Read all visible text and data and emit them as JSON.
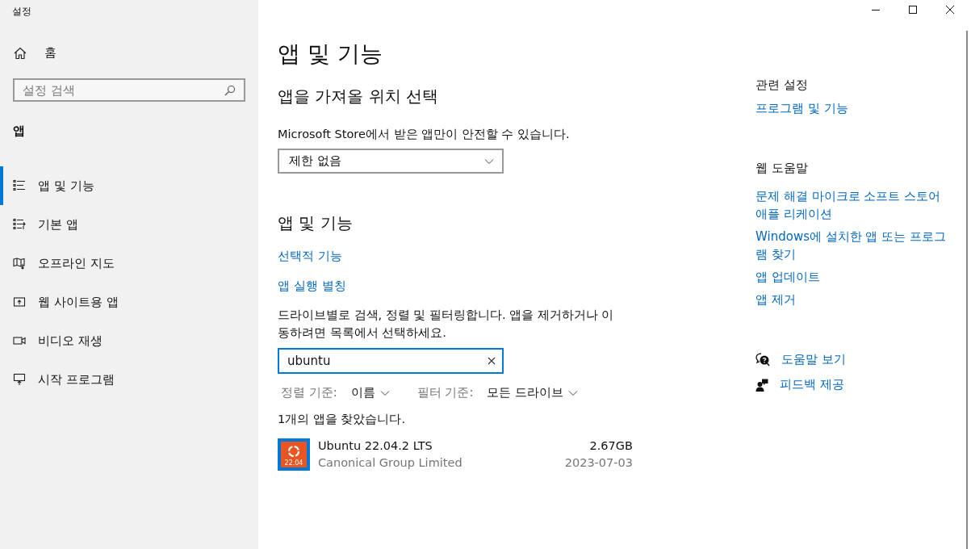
{
  "window": {
    "title": "설정"
  },
  "sidebar": {
    "home": "홈",
    "search": {
      "placeholder": "설정 검색"
    },
    "section": "앱",
    "items": [
      {
        "label": "앱 및 기능",
        "selected": true
      },
      {
        "label": "기본 앱",
        "selected": false
      },
      {
        "label": "오프라인 지도",
        "selected": false
      },
      {
        "label": "웹 사이트용 앱",
        "selected": false
      },
      {
        "label": "비디오 재생",
        "selected": false
      },
      {
        "label": "시작 프로그램",
        "selected": false
      }
    ]
  },
  "main": {
    "title": "앱 및 기능",
    "source": {
      "heading": "앱을 가져올 위치 선택",
      "description": "Microsoft Store에서 받은 앱만이 안전할 수 있습니다.",
      "dropdown": "제한 없음"
    },
    "apps": {
      "heading": "앱 및 기능",
      "links": [
        "선택적 기능",
        "앱 실행 별칭"
      ],
      "description": "드라이브별로 검색, 정렬 및 필터링합니다. 앱을 제거하거나 이동하려면 목록에서 선택하세요.",
      "search": {
        "value": "ubuntu"
      },
      "sort": {
        "label": "정렬 기준:",
        "value": "이름"
      },
      "filter": {
        "label": "필터 기준:",
        "value": "모든 드라이브"
      },
      "result_count": "1개의 앱을 찾았습니다.",
      "list": [
        {
          "name": "Ubuntu 22.04.2 LTS",
          "publisher": "Canonical Group Limited",
          "size": "2.67GB",
          "date": "2023-07-03",
          "icon_text": "22.04"
        }
      ]
    }
  },
  "related": {
    "heading": "관련 설정",
    "links": [
      "프로그램 및 기능"
    ]
  },
  "web_help": {
    "heading": "웹 도움말",
    "links": [
      "문제 해결 마이크로 소프트 스토어 애플 리케이션",
      "Windows에 설치한 앱 또는 프로그램 찾기",
      "앱 업데이트",
      "앱 제거"
    ]
  },
  "help_actions": [
    {
      "kind": "help",
      "label": "도움말 보기"
    },
    {
      "kind": "feedback",
      "label": "피드백 제공"
    }
  ]
}
